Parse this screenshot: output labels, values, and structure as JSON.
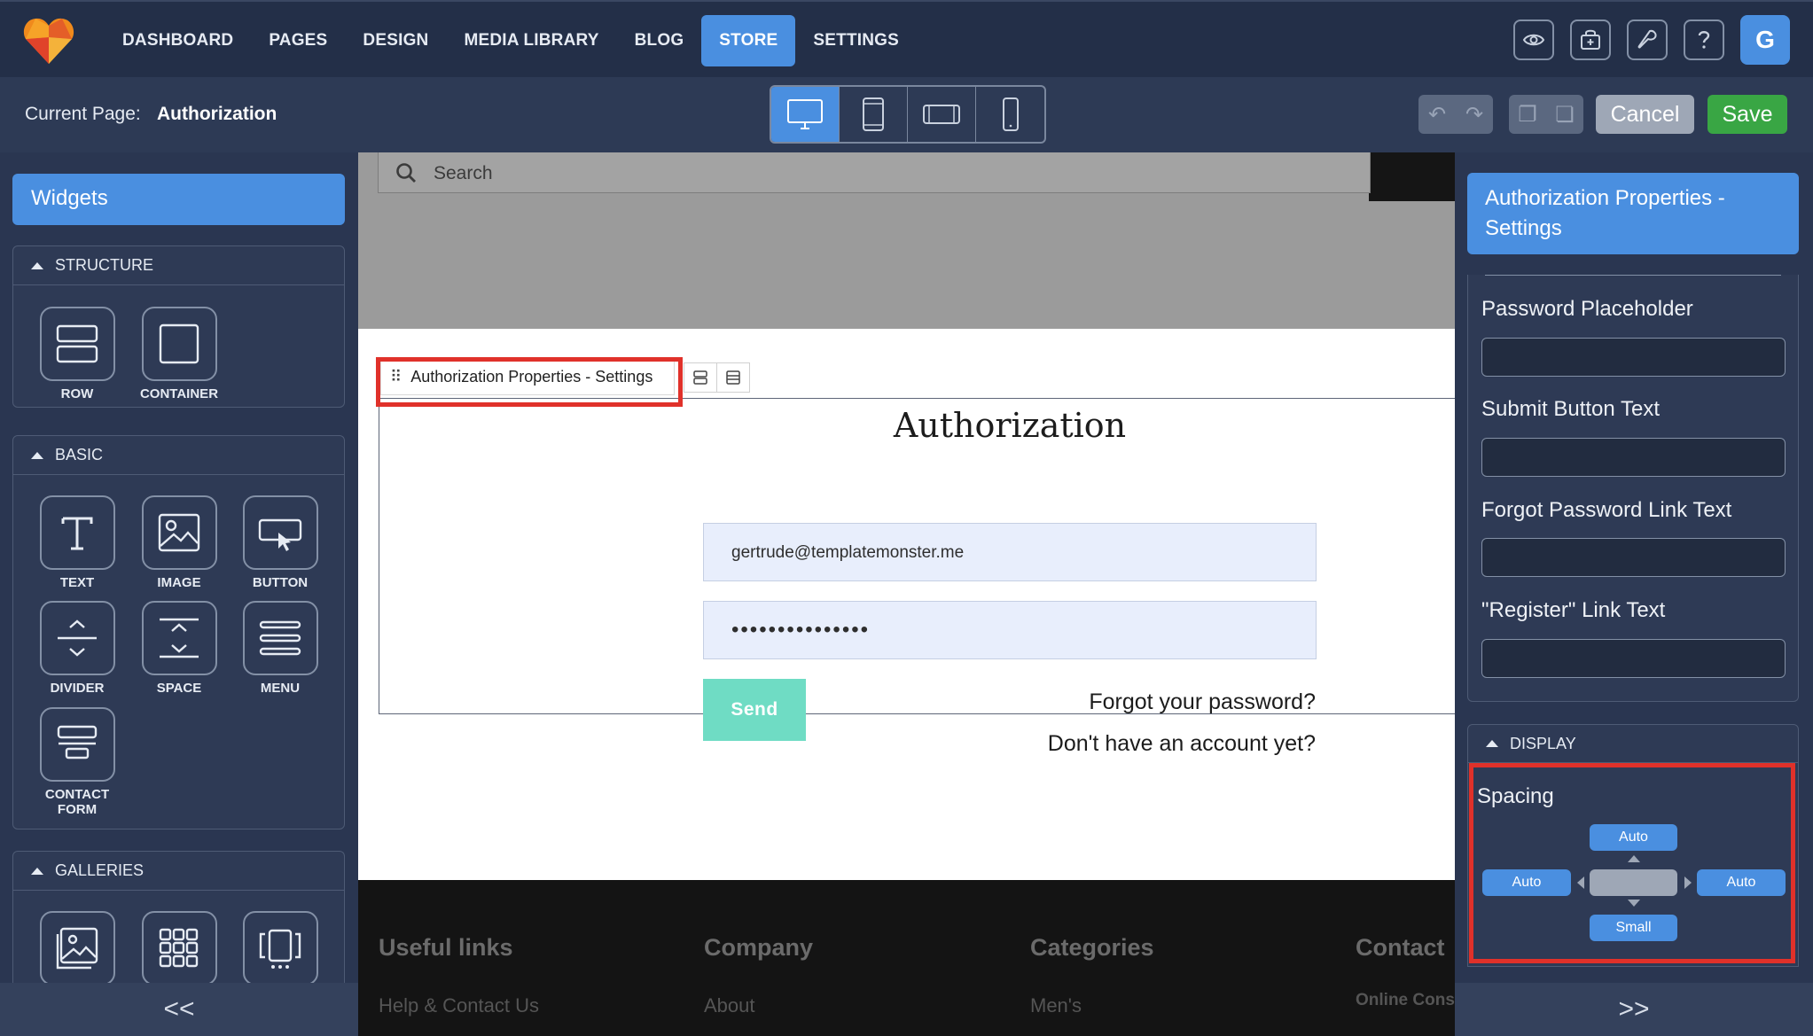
{
  "nav": {
    "items": [
      "DASHBOARD",
      "PAGES",
      "DESIGN",
      "MEDIA LIBRARY",
      "BLOG",
      "STORE",
      "SETTINGS"
    ],
    "active": "STORE",
    "avatar_initial": "G",
    "icons": [
      "preview-eye-icon",
      "store-bag-icon",
      "wrench-icon",
      "help-icon"
    ]
  },
  "subbar": {
    "current_page_label": "Current Page:",
    "current_page_value": "Authorization",
    "devices": [
      "desktop-icon",
      "tablet-portrait-icon",
      "tablet-landscape-icon",
      "mobile-icon"
    ],
    "active_device": "desktop-icon",
    "cancel_label": "Cancel",
    "save_label": "Save"
  },
  "left_panel": {
    "title": "Widgets",
    "groups": [
      {
        "label": "STRUCTURE",
        "widgets": [
          "ROW",
          "CONTAINER"
        ]
      },
      {
        "label": "BASIC",
        "widgets": [
          "TEXT",
          "IMAGE",
          "BUTTON",
          "DIVIDER",
          "SPACE",
          "MENU",
          "CONTACT FORM"
        ]
      },
      {
        "label": "GALLERIES",
        "widgets": [
          "",
          "",
          ""
        ]
      }
    ],
    "collapse_label": "<<"
  },
  "canvas": {
    "search_placeholder": "Search",
    "widget_label": "Authorization Properties - Settings",
    "title": "Authorization",
    "email_value": "gertrude@templatemonster.me",
    "password_value": "•••••••••••••••",
    "send_label": "Send",
    "forgot_link": "Forgot your password?",
    "register_link": "Don't have an account yet?",
    "footer": {
      "columns": [
        {
          "heading": "Useful links",
          "link": "Help & Contact Us"
        },
        {
          "heading": "Company",
          "link": "About"
        },
        {
          "heading": "Categories",
          "link": "Men's"
        },
        {
          "heading": "Contact",
          "link": "Online Cons"
        }
      ]
    }
  },
  "right_panel": {
    "title": "Authorization Properties - Settings",
    "fields": [
      {
        "label": "Password Placeholder",
        "value": ""
      },
      {
        "label": "Submit Button Text",
        "value": ""
      },
      {
        "label": "Forgot Password Link Text",
        "value": ""
      },
      {
        "label": "\"Register\" Link Text",
        "value": ""
      }
    ],
    "display_label": "DISPLAY",
    "spacing": {
      "title": "Spacing",
      "top": "Auto",
      "left": "Auto",
      "right": "Auto",
      "bottom": "Small"
    },
    "expand_label": ">>"
  },
  "colors": {
    "accent": "#4a8fe0",
    "save": "#39a644",
    "highlight": "#e0312a",
    "send": "#6fdcc4"
  }
}
